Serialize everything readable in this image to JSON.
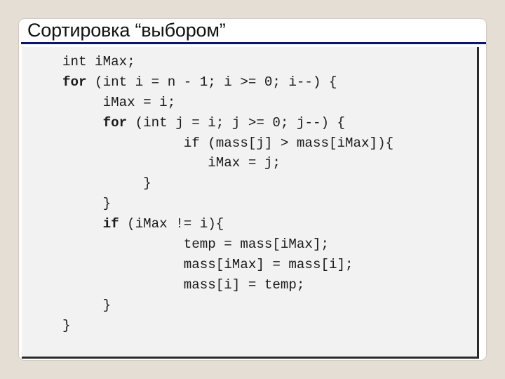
{
  "slide": {
    "title": "Сортировка “выбором”"
  },
  "code": {
    "lines": [
      {
        "indent": "",
        "keyword": "",
        "text": "int iMax;"
      },
      {
        "indent": "",
        "keyword": "for",
        "text": " (int i = n - 1; i >= 0; i--) {"
      },
      {
        "indent": "     ",
        "keyword": "",
        "text": "iMax = i;"
      },
      {
        "indent": "     ",
        "keyword": "for",
        "text": " (int j = i; j >= 0; j--) {"
      },
      {
        "indent": "               ",
        "keyword": "",
        "text": "if (mass[j] > mass[iMax]){"
      },
      {
        "indent": "                  ",
        "keyword": "",
        "text": "iMax = j;"
      },
      {
        "indent": "          ",
        "keyword": "",
        "text": "}"
      },
      {
        "indent": "     ",
        "keyword": "",
        "text": "}"
      },
      {
        "indent": "     ",
        "keyword": "if",
        "text": " (iMax != i){"
      },
      {
        "indent": "               ",
        "keyword": "",
        "text": "temp = mass[iMax];"
      },
      {
        "indent": "               ",
        "keyword": "",
        "text": "mass[iMax] = mass[i];"
      },
      {
        "indent": "               ",
        "keyword": "",
        "text": "mass[i] = temp;"
      },
      {
        "indent": "     ",
        "keyword": "",
        "text": "}"
      },
      {
        "indent": "",
        "keyword": "",
        "text": "}"
      }
    ]
  },
  "colors": {
    "background": "#e4ded4",
    "title_rule": "#0b1668",
    "code_panel": "#f2f2f2"
  }
}
